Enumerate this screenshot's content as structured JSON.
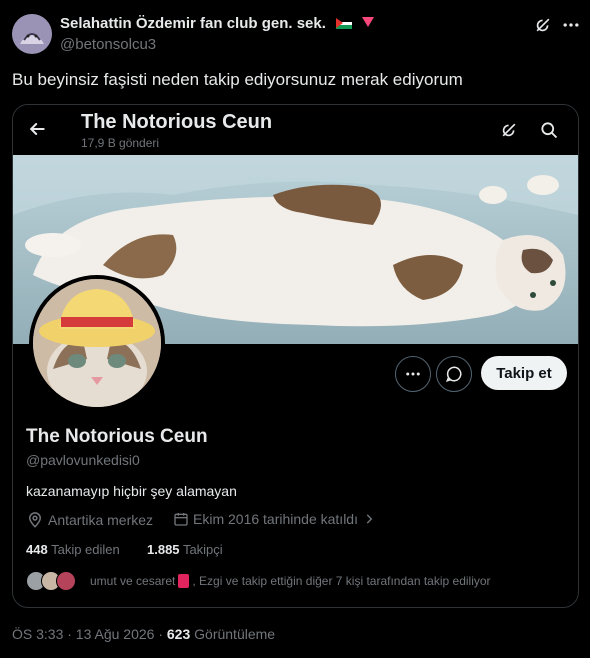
{
  "tweet": {
    "author_name": "Selahattin Özdemir fan club gen. sek.",
    "author_handle": "@betonsolcu3",
    "text": "Bu beyinsiz faşisti neden takip ediyorsunuz merak ediyorum",
    "timestamp": "ÖS 3:33 · 13 Ağu 2026 · ",
    "views_count": "623",
    "views_label": " Görüntüleme"
  },
  "icons": [
    "grok-icon",
    "more-icon",
    "back-arrow-icon",
    "search-icon",
    "location-icon",
    "calendar-icon",
    "chevron-right-icon",
    "message-icon"
  ],
  "embedded_profile": {
    "header_title": "The Notorious Ceun",
    "header_posts": "17,9 B gönderi",
    "name": "The Notorious Ceun",
    "handle": "@pavlovunkedisi0",
    "bio": "kazanamayıp hiçbir şey alamayan",
    "location": "Antartika merkez",
    "joined": "Ekim 2016 tarihinde katıldı",
    "following_count": "448",
    "following_label": "Takip edilen",
    "followers_count": "1.885",
    "followers_label": "Takipçi",
    "followed_by_part1": "umut ve cesaret",
    "followed_by_part2": ", Ezgi ve takip ettiğin diğer 7 kişi tarafından takip ediliyor",
    "follow_button": "Takip et"
  },
  "colors": {
    "background": "#000000",
    "text_primary": "#e7e9ea",
    "text_secondary": "#71767b",
    "border": "#2f3336",
    "follow_button_bg": "#eff3f4",
    "red_triangle": "#f7487b"
  }
}
